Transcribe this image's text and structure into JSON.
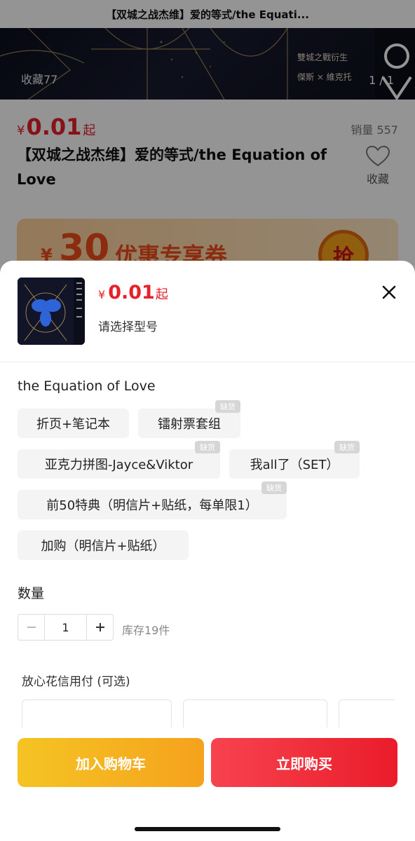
{
  "page_title": "【双城之战杰维】爱的等式/the Equati...",
  "banner": {
    "favorites_label": "收藏77",
    "pager": "1 / 1",
    "side_text_line1": "雙城之戰衍生",
    "side_text_line2": "傑斯 × 維克托"
  },
  "product": {
    "currency": "¥",
    "price": "0.01",
    "price_suffix": "起",
    "sales": "销量 557",
    "title": "【双城之战杰维】爱的等式/the Equation of Love",
    "favorite_label": "收藏"
  },
  "coupon": {
    "currency": "¥",
    "amount": "30",
    "text": "优惠专享券",
    "grab_label": "抢"
  },
  "sheet": {
    "currency": "¥",
    "price": "0.01",
    "price_suffix": "起",
    "subtitle": "请选择型号",
    "option_group_title": "the Equation of Love",
    "options": [
      {
        "label": "折页+笔记本",
        "tag": ""
      },
      {
        "label": "镭射票套组",
        "tag": "缺货"
      },
      {
        "label": "亚克力拼图-Jayce&Viktor",
        "tag": "缺货"
      },
      {
        "label": "我all了（SET）",
        "tag": "缺货"
      },
      {
        "label": "前50特典（明信片+贴纸，每单限1）",
        "tag": "缺货"
      },
      {
        "label": "加购（明信片+贴纸）",
        "tag": ""
      }
    ],
    "quantity_title": "数量",
    "quantity_value": "1",
    "stock_text": "库存19件",
    "credit_title": "放心花信用付 (可选)"
  },
  "footer": {
    "add_to_cart": "加入购物车",
    "buy_now": "立即购买"
  },
  "colors": {
    "price_red": "#e8202a",
    "cart_yellow": "#f5b321",
    "buy_red": "#f0303c"
  },
  "icons": [
    "heart-icon",
    "close-icon",
    "minus-icon",
    "plus-icon"
  ]
}
